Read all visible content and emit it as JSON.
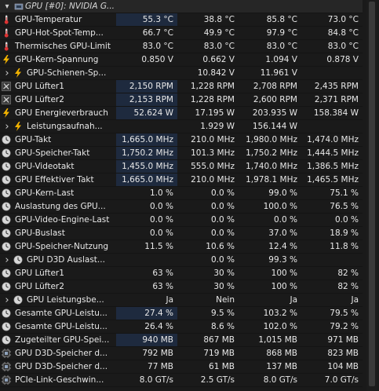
{
  "group": {
    "title": "GPU [#0]: NVIDIA G..."
  },
  "rows": [
    {
      "icon": "thermometer",
      "indent": 0,
      "label": "GPU-Temperatur",
      "v": [
        "55.3 °C",
        "38.8 °C",
        "85.8 °C",
        "73.0 °C"
      ],
      "hl": true
    },
    {
      "icon": "thermometer",
      "indent": 0,
      "label": "GPU-Hot-Spot-Temp...",
      "v": [
        "66.7 °C",
        "49.9 °C",
        "97.9 °C",
        "84.8 °C"
      ],
      "hl": false
    },
    {
      "icon": "thermometer",
      "indent": 0,
      "label": "Thermisches GPU-Limit",
      "v": [
        "83.0 °C",
        "83.0 °C",
        "83.0 °C",
        "83.0 °C"
      ],
      "hl": false
    },
    {
      "icon": "bolt",
      "indent": 0,
      "label": "GPU-Kern-Spannung",
      "v": [
        "0.850 V",
        "0.662 V",
        "1.094 V",
        "0.878 V"
      ],
      "hl": false
    },
    {
      "icon": "bolt",
      "indent": 1,
      "expander": true,
      "label": "GPU-Schienen-Sp...",
      "v": [
        "",
        "10.842 V",
        "11.961 V",
        ""
      ],
      "hl": false
    },
    {
      "icon": "fan",
      "indent": 0,
      "label": "GPU Lüfter1",
      "v": [
        "2,150 RPM",
        "1,228 RPM",
        "2,708 RPM",
        "2,435 RPM"
      ],
      "hl": true
    },
    {
      "icon": "fan",
      "indent": 0,
      "label": "GPU Lüfter2",
      "v": [
        "2,153 RPM",
        "1,228 RPM",
        "2,600 RPM",
        "2,371 RPM"
      ],
      "hl": true
    },
    {
      "icon": "bolt",
      "indent": 0,
      "label": "GPU Energieverbrauch",
      "v": [
        "52.624 W",
        "17.195 W",
        "203.935 W",
        "158.384 W"
      ],
      "hl": true
    },
    {
      "icon": "bolt",
      "indent": 1,
      "expander": true,
      "label": "Leistungsaufnah...",
      "v": [
        "",
        "1.929 W",
        "156.144 W",
        ""
      ],
      "hl": false
    },
    {
      "icon": "clock",
      "indent": 0,
      "label": "GPU-Takt",
      "v": [
        "1,665.0 MHz",
        "210.0 MHz",
        "1,980.0 MHz",
        "1,474.0 MHz"
      ],
      "hl": true
    },
    {
      "icon": "clock",
      "indent": 0,
      "label": "GPU-Speicher-Takt",
      "v": [
        "1,750.2 MHz",
        "101.3 MHz",
        "1,750.2 MHz",
        "1,444.5 MHz"
      ],
      "hl": true
    },
    {
      "icon": "clock",
      "indent": 0,
      "label": "GPU-Videotakt",
      "v": [
        "1,455.0 MHz",
        "555.0 MHz",
        "1,740.0 MHz",
        "1,386.5 MHz"
      ],
      "hl": true
    },
    {
      "icon": "clock",
      "indent": 0,
      "label": "GPU Effektiver Takt",
      "v": [
        "1,665.0 MHz",
        "210.0 MHz",
        "1,978.1 MHz",
        "1,465.5 MHz"
      ],
      "hl": true
    },
    {
      "icon": "clock",
      "indent": 0,
      "label": "GPU-Kern-Last",
      "v": [
        "1.0 %",
        "0.0 %",
        "99.0 %",
        "75.1 %"
      ],
      "hl": false
    },
    {
      "icon": "clock",
      "indent": 0,
      "label": "Auslastung des GPU...",
      "v": [
        "0.0 %",
        "0.0 %",
        "100.0 %",
        "76.5 %"
      ],
      "hl": false
    },
    {
      "icon": "clock",
      "indent": 0,
      "label": "GPU-Video-Engine-Last",
      "v": [
        "0.0 %",
        "0.0 %",
        "0.0 %",
        "0.0 %"
      ],
      "hl": false
    },
    {
      "icon": "clock",
      "indent": 0,
      "label": "GPU-Buslast",
      "v": [
        "0.0 %",
        "0.0 %",
        "37.0 %",
        "18.9 %"
      ],
      "hl": false
    },
    {
      "icon": "clock",
      "indent": 0,
      "label": "GPU-Speicher-Nutzung",
      "v": [
        "11.5 %",
        "10.6 %",
        "12.4 %",
        "11.8 %"
      ],
      "hl": false
    },
    {
      "icon": "clock",
      "indent": 1,
      "expander": true,
      "label": "GPU D3D Auslast...",
      "v": [
        "",
        "0.0 %",
        "99.3 %",
        ""
      ],
      "hl": false
    },
    {
      "icon": "clock",
      "indent": 0,
      "label": "GPU Lüfter1",
      "v": [
        "63 %",
        "30 %",
        "100 %",
        "82 %"
      ],
      "hl": false
    },
    {
      "icon": "clock",
      "indent": 0,
      "label": "GPU Lüfter2",
      "v": [
        "63 %",
        "30 %",
        "100 %",
        "82 %"
      ],
      "hl": false
    },
    {
      "icon": "clock",
      "indent": 1,
      "expander": true,
      "label": "GPU Leistungsbe...",
      "v": [
        "Ja",
        "Nein",
        "Ja",
        "Ja"
      ],
      "hl": false
    },
    {
      "icon": "clock",
      "indent": 0,
      "label": "Gesamte GPU-Leistu...",
      "v": [
        "27.4 %",
        "9.5 %",
        "103.2 %",
        "79.5 %"
      ],
      "hl": true
    },
    {
      "icon": "clock",
      "indent": 0,
      "label": "Gesamte GPU-Leistu...",
      "v": [
        "26.4 %",
        "8.6 %",
        "102.0 %",
        "79.2 %"
      ],
      "hl": false
    },
    {
      "icon": "clock",
      "indent": 0,
      "label": "Zugeteilter GPU-Spei...",
      "v": [
        "940 MB",
        "867 MB",
        "1,015 MB",
        "971 MB"
      ],
      "hl": true
    },
    {
      "icon": "chip",
      "indent": 0,
      "label": "GPU D3D-Speicher d...",
      "v": [
        "792 MB",
        "719 MB",
        "868 MB",
        "823 MB"
      ],
      "hl": false
    },
    {
      "icon": "chip",
      "indent": 0,
      "label": "GPU D3D-Speicher d...",
      "v": [
        "77 MB",
        "61 MB",
        "137 MB",
        "104 MB"
      ],
      "hl": false
    },
    {
      "icon": "chip",
      "indent": 0,
      "label": "PCIe-Link-Geschwin...",
      "v": [
        "8.0 GT/s",
        "2.5 GT/s",
        "8.0 GT/s",
        "7.0 GT/s"
      ],
      "hl": false
    }
  ]
}
